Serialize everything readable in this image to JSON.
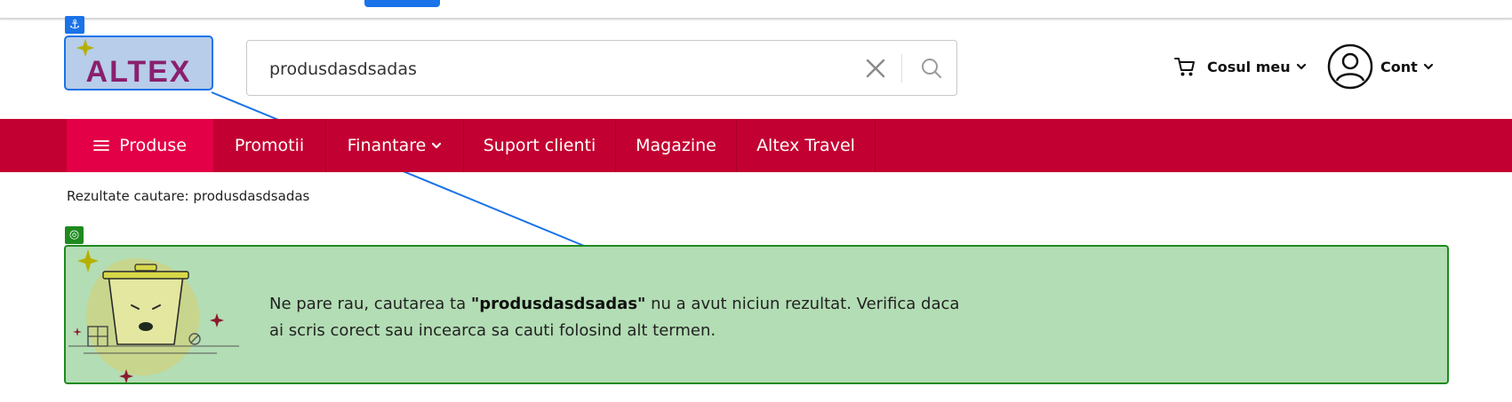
{
  "header": {
    "logo_text": "ALTEX",
    "search": {
      "value": "produsdasdsadas",
      "placeholder": ""
    },
    "cart_label": "Cosul meu",
    "account_label": "Cont"
  },
  "nav": {
    "items": [
      {
        "label": "Produse"
      },
      {
        "label": "Promotii"
      },
      {
        "label": "Finantare"
      },
      {
        "label": "Suport clienti"
      },
      {
        "label": "Magazine"
      },
      {
        "label": "Altex Travel"
      }
    ]
  },
  "breadcrumb": "Rezultate cautare: produsdasdsadas",
  "result": {
    "prefix": "Ne pare rau, cautarea ta ",
    "query": "\"produsdasdsadas\"",
    "suffix": " nu a avut niciun rezultat. Verifica daca ai scris corect sau incearca sa cauti folosind alt termen."
  },
  "overlay": {
    "anchor_icon": "anchor-icon",
    "target_icon": "target-icon",
    "colors": {
      "anchor": "#1a73e8",
      "target": "#1e8a1e"
    }
  },
  "colors": {
    "brand_red": "#c30032",
    "brand_pink": "#e30046",
    "logo_purple": "#8a1f6e",
    "logo_star": "#b5b000"
  }
}
